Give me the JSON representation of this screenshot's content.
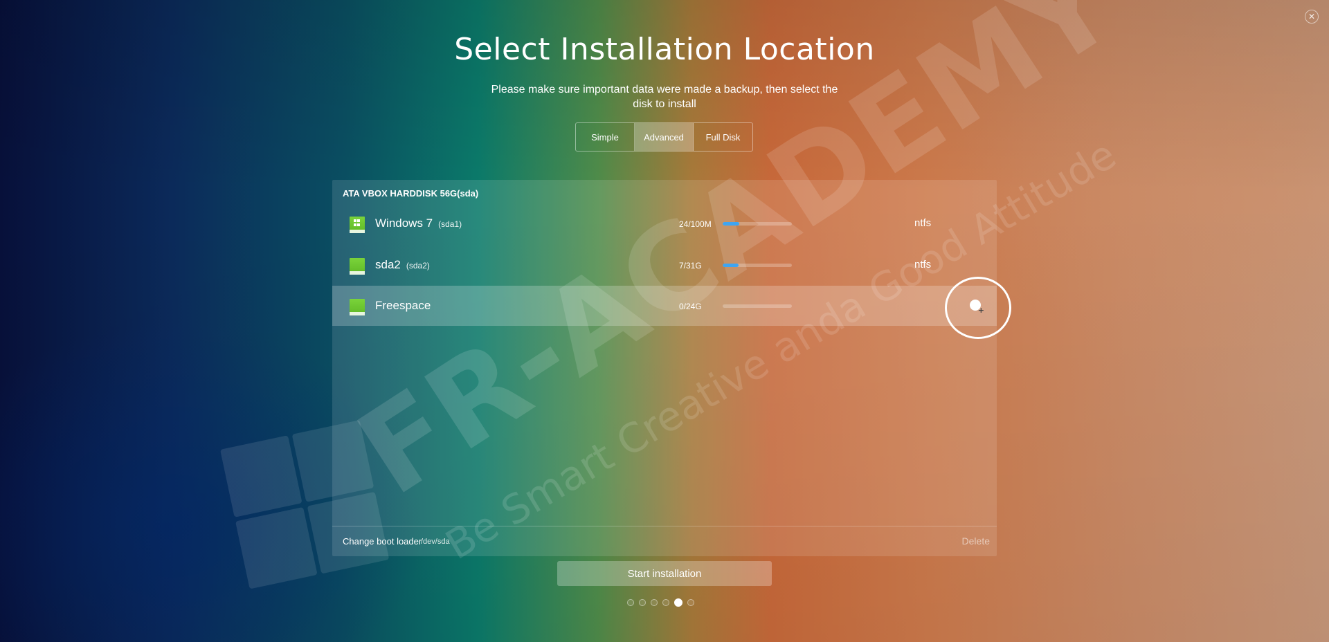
{
  "window": {
    "close_icon": "close-icon"
  },
  "header": {
    "title": "Select Installation Location",
    "subtitle": "Please make sure important data were made a backup, then select the disk to install"
  },
  "mode_tabs": [
    {
      "label": "Simple",
      "active": false
    },
    {
      "label": "Advanced",
      "active": true
    },
    {
      "label": "Full Disk",
      "active": false
    }
  ],
  "disk": {
    "name": "ATA VBOX HARDDISK 56G(sda)",
    "partitions": [
      {
        "name": "Windows 7",
        "device": "(sda1)",
        "usage": "24/100M",
        "used_fraction": 0.24,
        "filesystem": "ntfs",
        "icon": "windows-disk-icon",
        "selected": false
      },
      {
        "name": "sda2",
        "device": "(sda2)",
        "usage": "7/31G",
        "used_fraction": 0.23,
        "filesystem": "ntfs",
        "icon": "disk-icon",
        "selected": false
      },
      {
        "name": "Freespace",
        "device": "",
        "usage": "0/24G",
        "used_fraction": 0,
        "filesystem": "",
        "icon": "disk-icon",
        "selected": true,
        "action_icon": "new-partition-icon"
      }
    ]
  },
  "footer": {
    "boot_loader_label": "Change boot loader",
    "boot_loader_device": "/dev/sda",
    "delete_label": "Delete"
  },
  "start_button": "Start installation",
  "steps": {
    "total": 6,
    "current": 5
  },
  "watermark": {
    "brand": "FR-ACADEMY",
    "tagline": "Be Smart Creative anda Good Attitude"
  },
  "colors": {
    "usage_bar": "#3ea5f2",
    "partition_icon": "#6ac42e"
  }
}
